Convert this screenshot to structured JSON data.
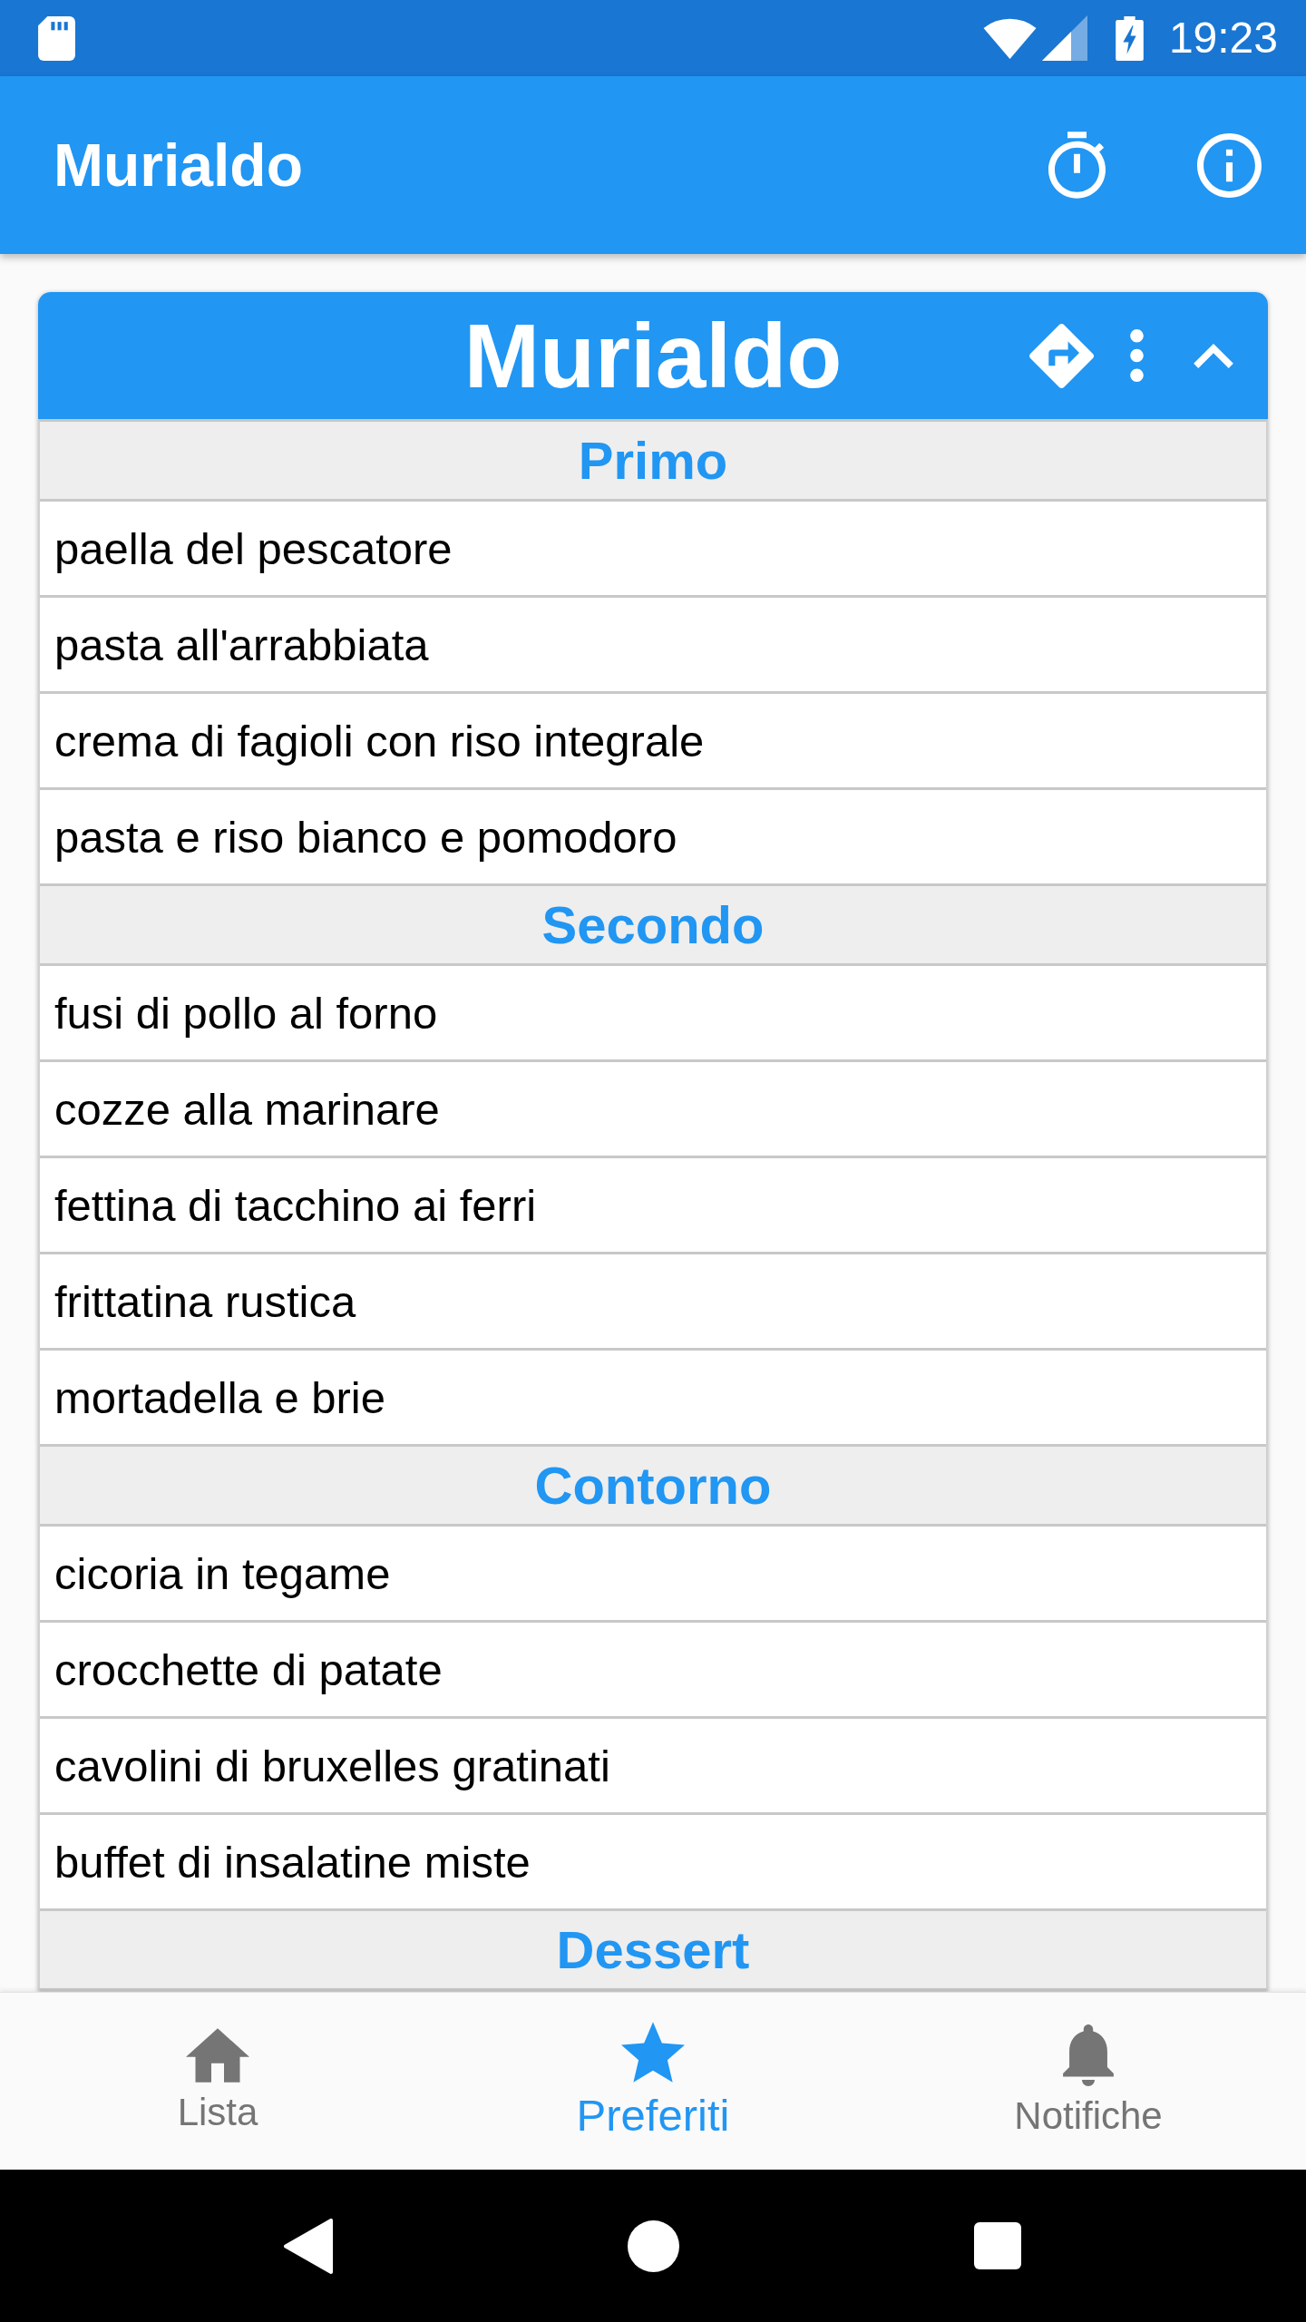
{
  "status_bar": {
    "time": "19:23"
  },
  "app_bar": {
    "title": "Murialdo"
  },
  "card": {
    "title": "Murialdo",
    "expanded": true,
    "sections": [
      {
        "title": "Primo",
        "items": [
          "paella del pescatore",
          "pasta all'arrabbiata",
          "crema di fagioli con riso integrale",
          "pasta e riso bianco e pomodoro"
        ]
      },
      {
        "title": "Secondo",
        "items": [
          "fusi di pollo al forno",
          "cozze alla marinare",
          "fettina di tacchino ai ferri",
          "frittatina rustica",
          "mortadella e brie"
        ]
      },
      {
        "title": "Contorno",
        "items": [
          "cicoria in tegame",
          "crocchette di patate",
          "cavolini di bruxelles gratinati",
          "buffet di insalatine miste"
        ]
      },
      {
        "title": "Dessert"
      }
    ]
  },
  "bottom_nav": {
    "items": [
      {
        "label": "Lista",
        "selected": false
      },
      {
        "label": "Preferiti",
        "selected": true
      },
      {
        "label": "Notifiche",
        "selected": false
      }
    ]
  }
}
